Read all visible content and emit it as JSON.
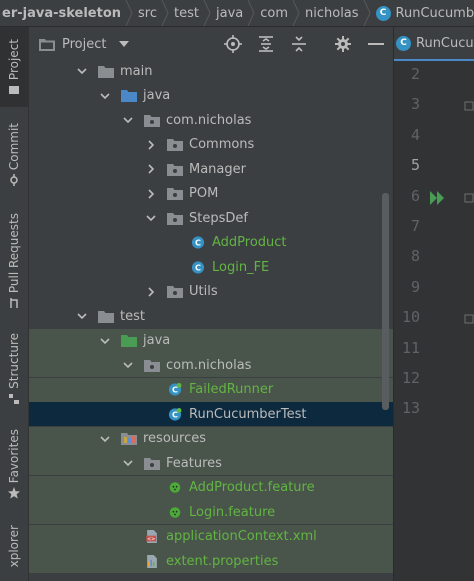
{
  "breadcrumbs": [
    {
      "label": "er-java-skeleton",
      "icon": null
    },
    {
      "label": "src",
      "icon": null
    },
    {
      "label": "test",
      "icon": null
    },
    {
      "label": "java",
      "icon": null
    },
    {
      "label": "com",
      "icon": null
    },
    {
      "label": "nicholas",
      "icon": null
    },
    {
      "label": "RunCucumber",
      "icon": "cucumber-class-icon"
    }
  ],
  "tool_stripe": {
    "project": "Project",
    "commit": "Commit",
    "pull_requests": "Pull Requests",
    "structure": "Structure",
    "favorites": "Favorites",
    "explorer": "xplorer"
  },
  "panel": {
    "title": "Project",
    "toolbar_icons": [
      "locate-icon",
      "expand-all-icon",
      "collapse-all-icon",
      "settings-icon",
      "hide-icon"
    ]
  },
  "tree": [
    {
      "label": "main",
      "depth": 0,
      "arrow": "down",
      "icon": "folder-icon",
      "color": "default",
      "scope": "none"
    },
    {
      "label": "java",
      "depth": 1,
      "arrow": "down",
      "icon": "source-folder-icon",
      "color": "default",
      "scope": "none"
    },
    {
      "label": "com.nicholas",
      "depth": 2,
      "arrow": "down",
      "icon": "package-icon",
      "color": "default",
      "scope": "none"
    },
    {
      "label": "Commons",
      "depth": 3,
      "arrow": "right",
      "icon": "package-icon",
      "color": "default",
      "scope": "none"
    },
    {
      "label": "Manager",
      "depth": 3,
      "arrow": "right",
      "icon": "package-icon",
      "color": "default",
      "scope": "none"
    },
    {
      "label": "POM",
      "depth": 3,
      "arrow": "right",
      "icon": "package-icon",
      "color": "default",
      "scope": "none"
    },
    {
      "label": "StepsDef",
      "depth": 3,
      "arrow": "down",
      "icon": "package-icon",
      "color": "default",
      "scope": "none"
    },
    {
      "label": "AddProduct",
      "depth": 4,
      "arrow": "none",
      "icon": "class-icon",
      "color": "green",
      "scope": "none"
    },
    {
      "label": "Login_FE",
      "depth": 4,
      "arrow": "none",
      "icon": "class-icon",
      "color": "green",
      "scope": "none"
    },
    {
      "label": "Utils",
      "depth": 3,
      "arrow": "right",
      "icon": "package-icon",
      "color": "default",
      "scope": "none"
    },
    {
      "label": "test",
      "depth": 0,
      "arrow": "down",
      "icon": "folder-icon",
      "color": "default",
      "scope": "none"
    },
    {
      "label": "java",
      "depth": 1,
      "arrow": "down",
      "icon": "test-source-folder-icon",
      "color": "default",
      "scope": "test"
    },
    {
      "label": "com.nicholas",
      "depth": 2,
      "arrow": "down",
      "icon": "package-icon",
      "color": "default",
      "scope": "test"
    },
    {
      "label": "FailedRunner",
      "depth": 3,
      "arrow": "none",
      "icon": "cucumber-class-icon",
      "color": "green",
      "scope": "test"
    },
    {
      "label": "RunCucumberTest",
      "depth": 3,
      "arrow": "none",
      "icon": "cucumber-class-icon",
      "color": "default",
      "scope": "selected"
    },
    {
      "label": "resources",
      "depth": 1,
      "arrow": "down",
      "icon": "resources-folder-icon",
      "color": "default",
      "scope": "test"
    },
    {
      "label": "Features",
      "depth": 2,
      "arrow": "down",
      "icon": "package-icon",
      "color": "default",
      "scope": "test"
    },
    {
      "label": "AddProduct.feature",
      "depth": 3,
      "arrow": "none",
      "icon": "cucumber-feature-icon",
      "color": "green",
      "scope": "test"
    },
    {
      "label": "Login.feature",
      "depth": 3,
      "arrow": "none",
      "icon": "cucumber-feature-icon",
      "color": "green",
      "scope": "test"
    },
    {
      "label": "applicationContext.xml",
      "depth": 2,
      "arrow": "none",
      "icon": "xml-file-icon",
      "color": "green",
      "scope": "test"
    },
    {
      "label": "extent.properties",
      "depth": 2,
      "arrow": "none",
      "icon": "properties-file-icon",
      "color": "green",
      "scope": "test"
    }
  ],
  "editor": {
    "tab_label": "RunCucumber",
    "line_numbers": [
      "2",
      "3",
      "4",
      "5",
      "6",
      "7",
      "8",
      "9",
      "10",
      "11",
      "12",
      "13"
    ],
    "current_line": "5",
    "run_gutter_line": "6"
  },
  "colors": {
    "green_text": "#62b543",
    "selection": "#0d293e",
    "test_scope": "#49544a",
    "accent": "#3592c4"
  }
}
